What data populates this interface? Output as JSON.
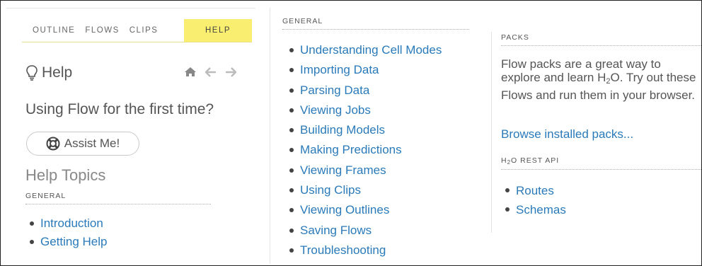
{
  "sidebar": {
    "tabs": [
      "OUTLINE",
      "FLOWS",
      "CLIPS",
      "HELP"
    ],
    "active_tab": "HELP",
    "help_title": "Help",
    "subtitle": "Using Flow for the first time?",
    "assist_button": "Assist Me!",
    "help_topics": "Help Topics",
    "general_label": "GENERAL",
    "links": [
      "Introduction",
      "Getting Help"
    ]
  },
  "main": {
    "general_label": "GENERAL",
    "links": [
      "Understanding Cell Modes",
      "Importing Data",
      "Parsing Data",
      "Viewing Jobs",
      "Building Models",
      "Making Predictions",
      "Viewing Frames",
      "Using Clips",
      "Viewing Outlines",
      "Saving Flows",
      "Troubleshooting"
    ]
  },
  "packs": {
    "label": "PACKS",
    "description_part1": "Flow packs are a great way to explore and learn H",
    "description_sub": "2",
    "description_part2": "O. Try out these Flows and run them in your browser.",
    "browse_link": "Browse installed packs..."
  },
  "rest_api": {
    "label_prefix": "H",
    "label_sub": "2",
    "label_suffix": "O REST API",
    "links": [
      "Routes",
      "Schemas"
    ]
  },
  "colors": {
    "accent_tab": "#f9ee6f",
    "link": "#2a7ab9"
  }
}
